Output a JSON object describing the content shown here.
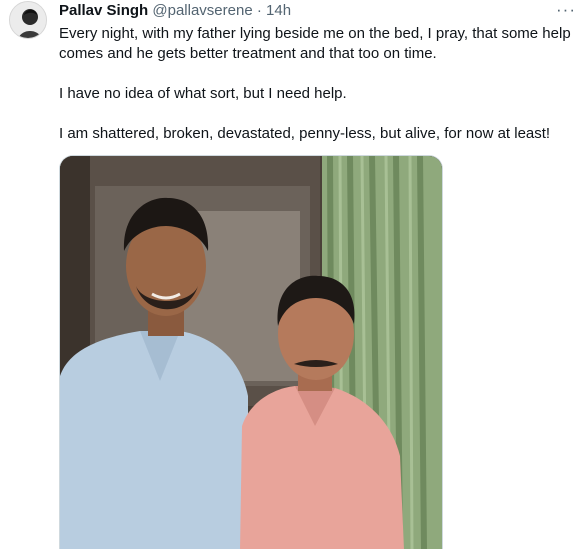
{
  "tweet": {
    "author_name": "Pallav Singh",
    "handle": "@pallavserene",
    "separator": "·",
    "time": "14h",
    "more_glyph": "···",
    "paragraphs": [
      "Every night, with my father lying beside me on the bed, I pray, that some help comes and he gets better treatment and that too on time.",
      "I have no idea of what sort, but I need help.",
      "I am shattered, broken, devastated, penny-less, but alive, for now at least!"
    ]
  },
  "icons": {
    "avatar": "user-avatar",
    "more": "more-options-icon"
  },
  "colors": {
    "text_primary": "#0f1419",
    "text_secondary": "#536471",
    "border": "#cfd9de"
  }
}
